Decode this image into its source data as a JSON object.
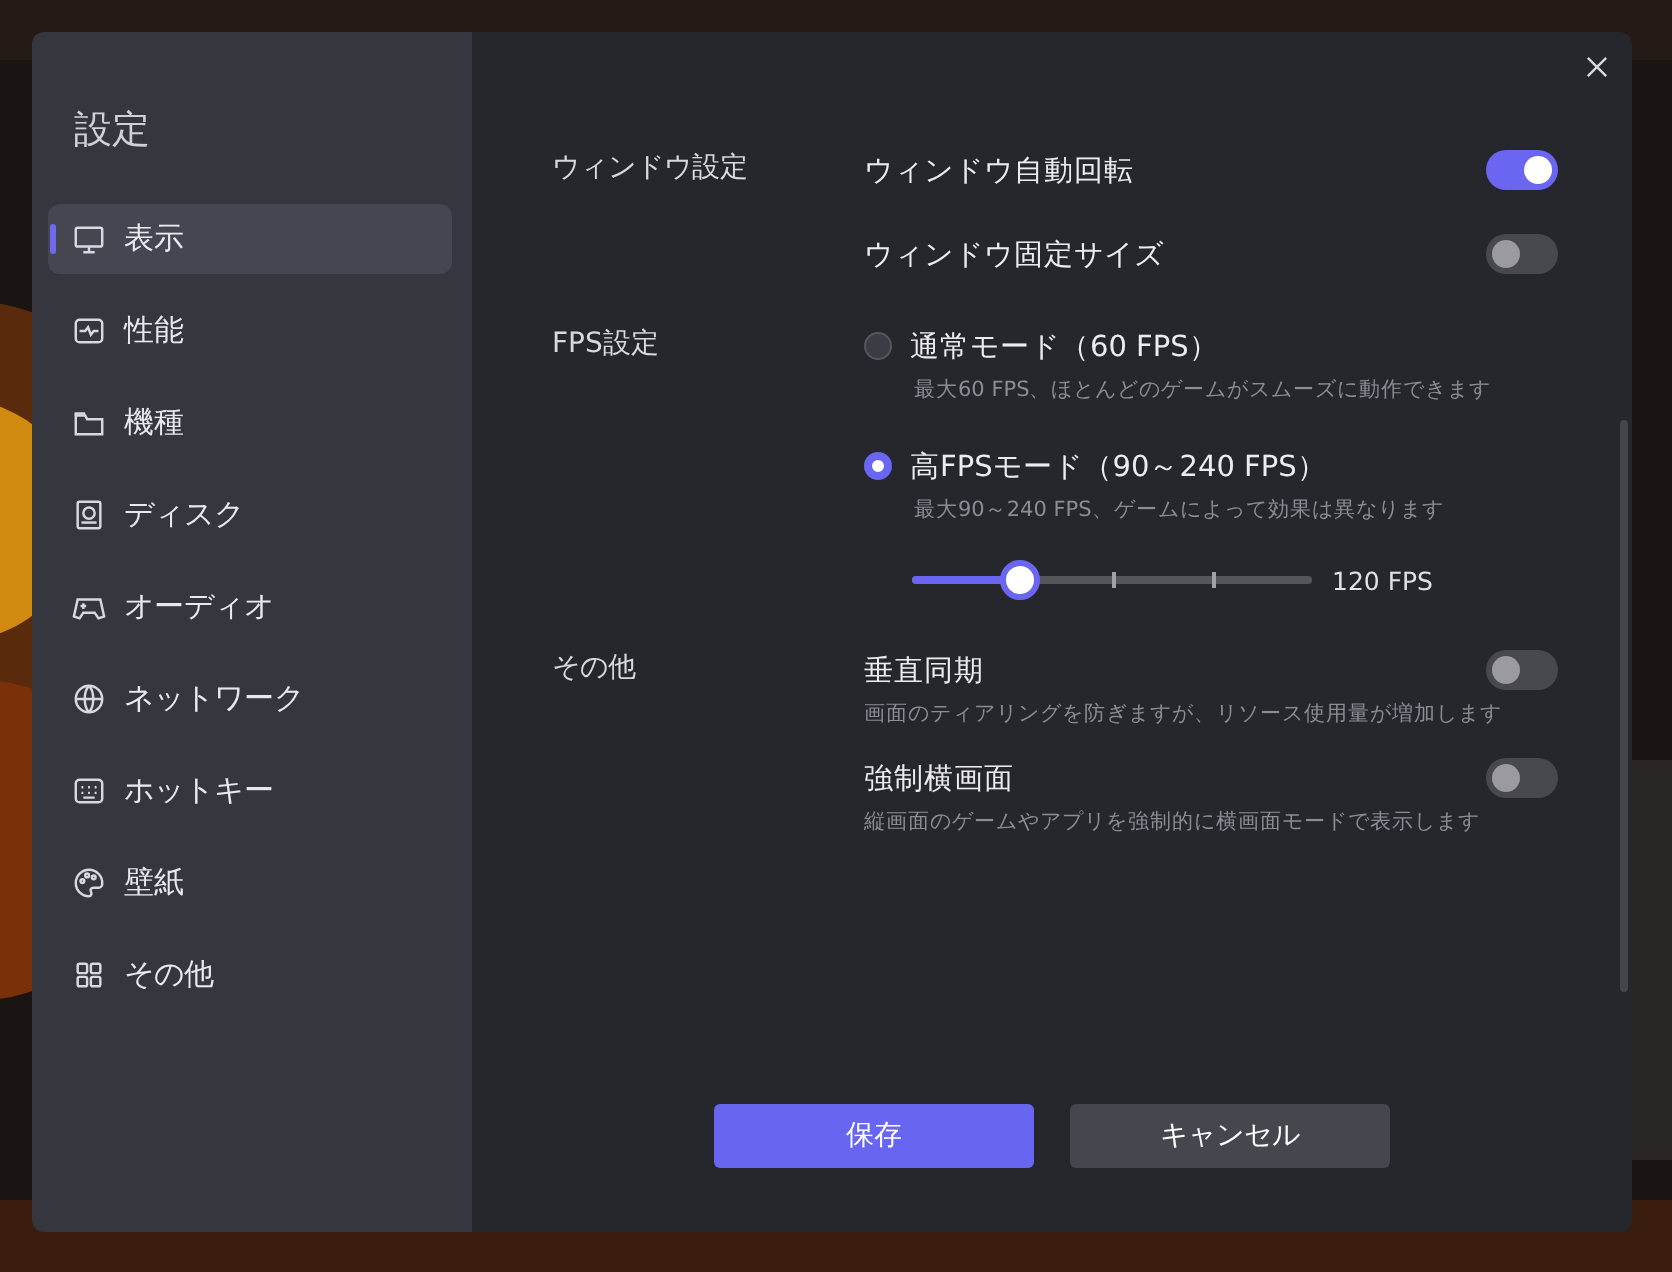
{
  "title": "設定",
  "sidebar": {
    "items": [
      {
        "label": "表示",
        "selected": true
      },
      {
        "label": "性能",
        "selected": false
      },
      {
        "label": "機種",
        "selected": false
      },
      {
        "label": "ディスク",
        "selected": false
      },
      {
        "label": "オーディオ",
        "selected": false
      },
      {
        "label": "ネットワーク",
        "selected": false
      },
      {
        "label": "ホットキー",
        "selected": false
      },
      {
        "label": "壁紙",
        "selected": false
      },
      {
        "label": "その他",
        "selected": false
      }
    ]
  },
  "sections": [
    {
      "label": "ウィンドウ設定",
      "rows": [
        {
          "kind": "toggle",
          "label": "ウィンドウ自動回転",
          "on": true
        },
        {
          "kind": "toggle",
          "label": "ウィンドウ固定サイズ",
          "on": false
        }
      ]
    },
    {
      "label": "FPS設定",
      "rows": [
        {
          "kind": "radio",
          "label": "通常モード（60 FPS）",
          "description": "最大60 FPS、ほとんどのゲームがスムーズに動作できます",
          "selected": false
        },
        {
          "kind": "radio",
          "label": "高FPSモード（90～240 FPS）",
          "description": "最大90～240 FPS、ゲームによって効果は異なります",
          "selected": true,
          "slider": {
            "level": 0.27,
            "reading": "120 FPS"
          }
        }
      ]
    },
    {
      "label": "その他",
      "rows": [
        {
          "kind": "toggle",
          "label": "垂直同期",
          "description": "画面のティアリングを防ぎますが、リソース使用量が増加します",
          "on": false
        },
        {
          "kind": "toggle",
          "label": "強制横画面",
          "description": "縦画面のゲームやアプリを強制的に横画面モードで表示します",
          "on": false
        }
      ]
    }
  ],
  "buttons": [
    {
      "label": "保存",
      "kind": "primary"
    },
    {
      "label": "キャンセル",
      "kind": "secondary"
    }
  ]
}
